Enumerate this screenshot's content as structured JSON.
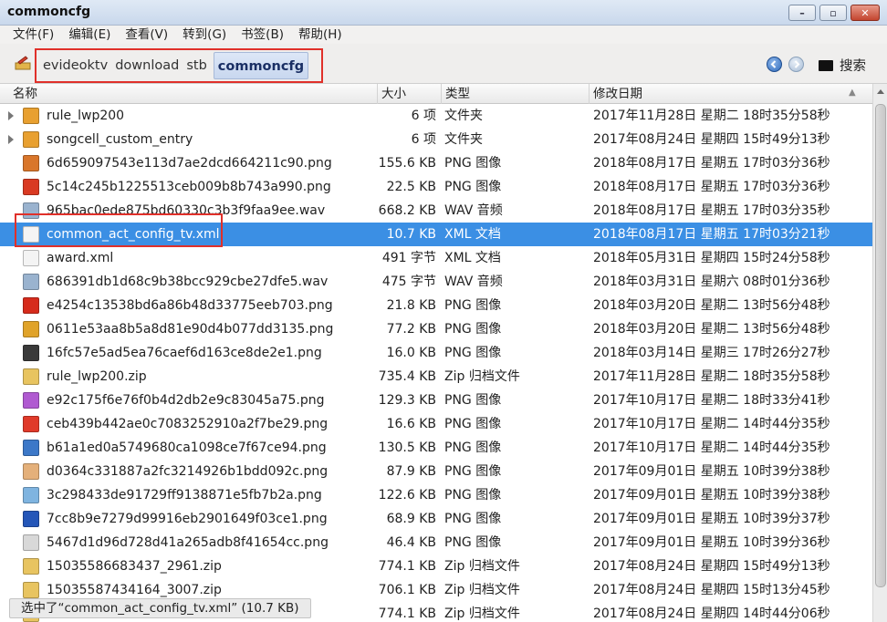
{
  "window": {
    "title": "commoncfg"
  },
  "menu": [
    "文件(F)",
    "编辑(E)",
    "查看(V)",
    "转到(G)",
    "书签(B)",
    "帮助(H)"
  ],
  "breadcrumb": [
    "evideoktv",
    "download",
    "stb",
    "commoncfg"
  ],
  "search_label": "搜索",
  "columns": {
    "name": "名称",
    "size": "大小",
    "type": "类型",
    "modified": "修改日期"
  },
  "files": [
    {
      "name": "rule_lwp200",
      "size": "6 项",
      "type": "文件夹",
      "date": "2017年11月28日 星期二 18时35分58秒",
      "icon": "folder-icon",
      "expandable": true
    },
    {
      "name": "songcell_custom_entry",
      "size": "6 项",
      "type": "文件夹",
      "date": "2017年08月24日 星期四 15时49分13秒",
      "icon": "folder-icon",
      "expandable": true
    },
    {
      "name": "6d659097543e113d7ae2dcd664211c90.png",
      "size": "155.6 KB",
      "type": "PNG 图像",
      "date": "2018年08月17日 星期五 17时03分36秒",
      "icon": "image-icon"
    },
    {
      "name": "5c14c245b1225513ceb009b8b743a990.png",
      "size": "22.5 KB",
      "type": "PNG 图像",
      "date": "2018年08月17日 星期五 17时03分36秒",
      "icon": "image-icon"
    },
    {
      "name": "965bac0ede875bd60330c3b3f9faa9ee.wav",
      "size": "668.2 KB",
      "type": "WAV 音频",
      "date": "2018年08月17日 星期五 17时03分35秒",
      "icon": "audio-icon"
    },
    {
      "name": "common_act_config_tv.xml",
      "size": "10.7 KB",
      "type": "XML 文档",
      "date": "2018年08月17日 星期五 17时03分21秒",
      "icon": "xml-document-icon",
      "selected": true
    },
    {
      "name": "award.xml",
      "size": "491 字节",
      "type": "XML 文档",
      "date": "2018年05月31日 星期四 15时24分58秒",
      "icon": "xml-document-icon"
    },
    {
      "name": "686391db1d68c9b38bcc929cbe27dfe5.wav",
      "size": "475 字节",
      "type": "WAV 音频",
      "date": "2018年03月31日 星期六 08时01分36秒",
      "icon": "audio-icon"
    },
    {
      "name": "e4254c13538bd6a86b48d33775eeb703.png",
      "size": "21.8 KB",
      "type": "PNG 图像",
      "date": "2018年03月20日 星期二 13时56分48秒",
      "icon": "image-icon"
    },
    {
      "name": "0611e53aa8b5a8d81e90d4b077dd3135.png",
      "size": "77.2 KB",
      "type": "PNG 图像",
      "date": "2018年03月20日 星期二 13时56分48秒",
      "icon": "image-icon"
    },
    {
      "name": "16fc57e5ad5ea76caef6d163ce8de2e1.png",
      "size": "16.0 KB",
      "type": "PNG 图像",
      "date": "2018年03月14日 星期三 17时26分27秒",
      "icon": "image-icon"
    },
    {
      "name": "rule_lwp200.zip",
      "size": "735.4 KB",
      "type": "Zip 归档文件",
      "date": "2017年11月28日 星期二 18时35分58秒",
      "icon": "archive-icon"
    },
    {
      "name": "e92c175f6e76f0b4d2db2e9c83045a75.png",
      "size": "129.3 KB",
      "type": "PNG 图像",
      "date": "2017年10月17日 星期二 18时33分41秒",
      "icon": "image-icon"
    },
    {
      "name": "ceb439b442ae0c7083252910a2f7be29.png",
      "size": "16.6 KB",
      "type": "PNG 图像",
      "date": "2017年10月17日 星期二 14时44分35秒",
      "icon": "image-icon"
    },
    {
      "name": "b61a1ed0a5749680ca1098ce7f67ce94.png",
      "size": "130.5 KB",
      "type": "PNG 图像",
      "date": "2017年10月17日 星期二 14时44分35秒",
      "icon": "image-icon"
    },
    {
      "name": "d0364c331887a2fc3214926b1bdd092c.png",
      "size": "87.9 KB",
      "type": "PNG 图像",
      "date": "2017年09月01日 星期五 10时39分38秒",
      "icon": "image-icon"
    },
    {
      "name": "3c298433de91729ff9138871e5fb7b2a.png",
      "size": "122.6 KB",
      "type": "PNG 图像",
      "date": "2017年09月01日 星期五 10时39分38秒",
      "icon": "image-icon"
    },
    {
      "name": "7cc8b9e7279d99916eb2901649f03ce1.png",
      "size": "68.9 KB",
      "type": "PNG 图像",
      "date": "2017年09月01日 星期五 10时39分37秒",
      "icon": "image-icon"
    },
    {
      "name": "5467d1d96d728d41a265adb8f41654cc.png",
      "size": "46.4 KB",
      "type": "PNG 图像",
      "date": "2017年09月01日 星期五 10时39分36秒",
      "icon": "image-icon"
    },
    {
      "name": "15035586683437_2961.zip",
      "size": "774.1 KB",
      "type": "Zip 归档文件",
      "date": "2017年08月24日 星期四 15时49分13秒",
      "icon": "archive-icon"
    },
    {
      "name": "15035587434164_3007.zip",
      "size": "706.1 KB",
      "type": "Zip 归档文件",
      "date": "2017年08月24日 星期四 15时13分45秒",
      "icon": "archive-icon"
    },
    {
      "name": "",
      "size": "774.1 KB",
      "type": "Zip 归档文件",
      "date": "2017年08月24日 星期四 14时44分06秒",
      "icon": "archive-icon"
    }
  ],
  "icon_colors": [
    "#e8a030",
    "#e8a030",
    "#d9762b",
    "#d93a22",
    "#9ab3cf",
    "#f4f4f4",
    "#f4f4f4",
    "#9ab3cf",
    "#d62b1c",
    "#e0a32a",
    "#3a3a3a",
    "#e8c460",
    "#b05ad1",
    "#e03a2a",
    "#3c78c8",
    "#e4b07a",
    "#7fb4e0",
    "#2456b8",
    "#d8d8d8",
    "#e8c460",
    "#e8c460",
    "#e8c460"
  ],
  "status": "选中了“common_act_config_tv.xml” (10.7 KB)"
}
